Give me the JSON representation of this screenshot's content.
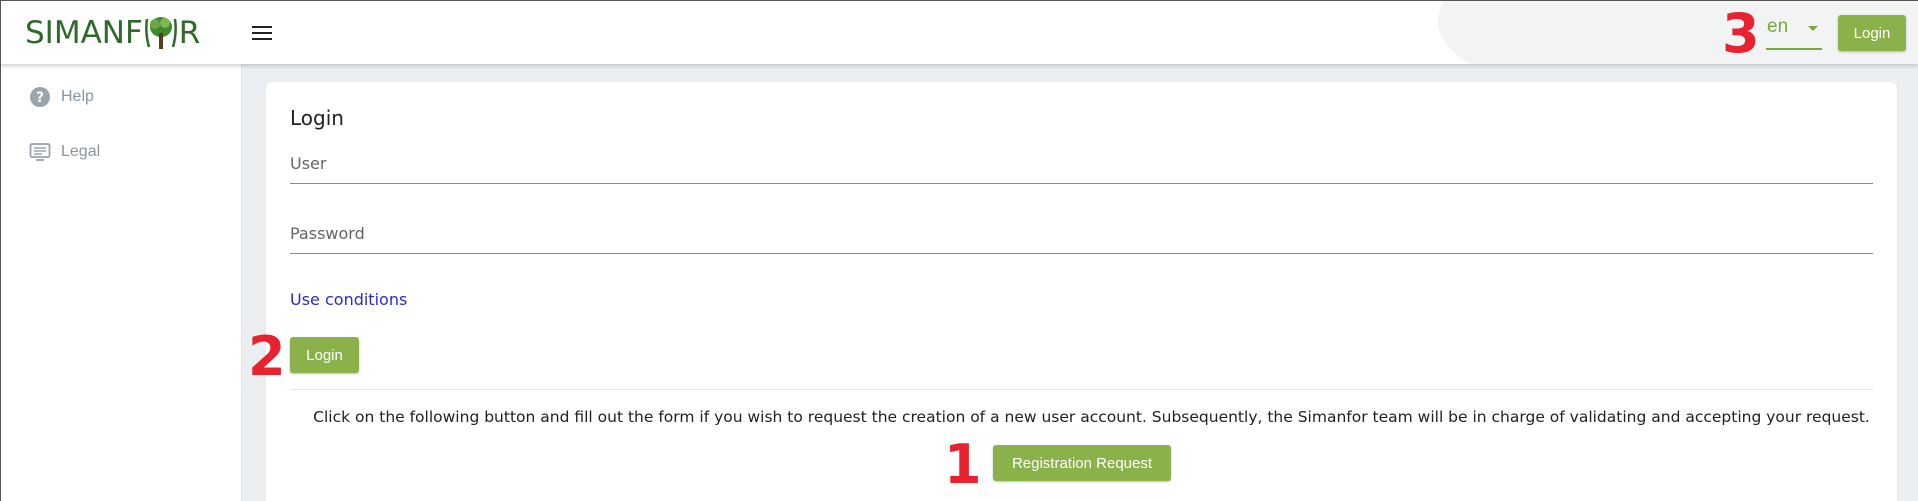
{
  "header": {
    "logo_left": "SIMANF",
    "logo_right": "R",
    "logo_full_text": "SIMANFOR",
    "language": "en",
    "login_label": "Login",
    "colors": {
      "accent": "#8bb24a",
      "logo": "#2f6a2a",
      "marker": "#e8222e"
    }
  },
  "sidebar": {
    "items": [
      {
        "label": "Help",
        "icon": "help-circle-icon"
      },
      {
        "label": "Legal",
        "icon": "legal-document-icon"
      }
    ]
  },
  "login_form": {
    "title": "Login",
    "user_placeholder": "User",
    "password_placeholder": "Password",
    "use_conditions_label": "Use conditions",
    "login_label": "Login"
  },
  "registration": {
    "info": "Click on the following button and fill out the form if you wish to request the creation of a new user account. Subsequently, the Simanfor team will be in charge of validating and accepting your request.",
    "button_label": "Registration Request"
  },
  "markers": {
    "one": "1",
    "two": "2",
    "three": "3"
  }
}
